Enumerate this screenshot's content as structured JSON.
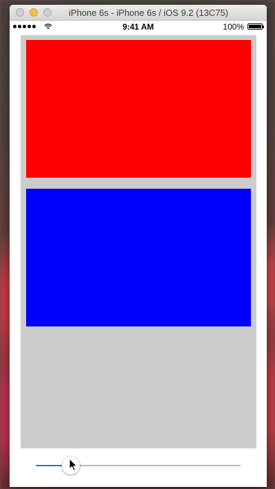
{
  "window": {
    "title": "iPhone 6s - iPhone 6s / iOS 9.2 (13C75)"
  },
  "status_bar": {
    "time": "9:41 AM",
    "battery_percent": "100%",
    "signal_icon": "signal-dots-icon",
    "wifi_icon": "wifi-icon",
    "battery_icon": "battery-icon"
  },
  "content": {
    "container_color": "#cccccc",
    "top_view_color": "#ff0000",
    "bottom_view_color": "#0000ff"
  },
  "slider": {
    "value": 0.17,
    "min_track_color": "#1a7dc4",
    "max_track_color": "#b7b7b7"
  }
}
